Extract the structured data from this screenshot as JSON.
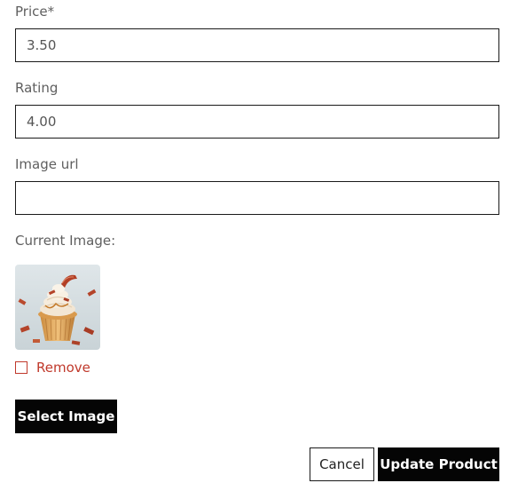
{
  "form": {
    "price": {
      "label": "Price*",
      "value": "3.50"
    },
    "rating": {
      "label": "Rating",
      "value": "4.00"
    },
    "image_url": {
      "label": "Image url",
      "value": ""
    },
    "current_image": {
      "label": "Current Image:",
      "alt": "cupcake-image"
    },
    "remove": {
      "label": "Remove",
      "checked": false
    },
    "select_image_label": "Select Image",
    "cancel_label": "Cancel",
    "update_label": "Update Product"
  },
  "colors": {
    "primary_button": "#050505",
    "danger_text": "#c0392b",
    "border": "#1a1a1a"
  }
}
